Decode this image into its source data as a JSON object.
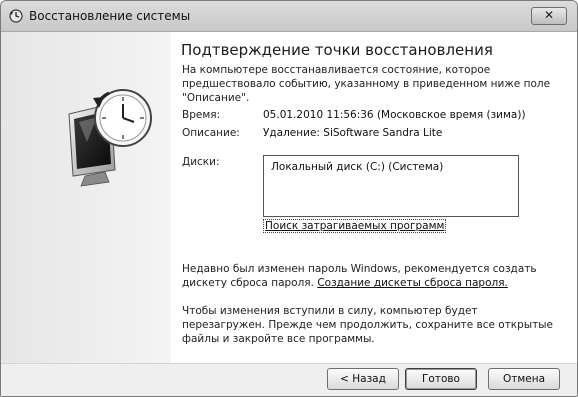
{
  "window": {
    "title": "Восстановление системы",
    "close_label": "✕"
  },
  "main": {
    "heading": "Подтверждение точки восстановления",
    "description": "На компьютере восстанавливается состояние, которое предшествовало событию, указанному в приведенном ниже поле \"Описание\".",
    "time_label": "Время:",
    "time_value": "05.01.2010 11:56:36 (Московское время (зима))",
    "description_label": "Описание:",
    "description_value": "Удаление: SiSoftware Sandra Lite",
    "disks_label": "Диски:",
    "disks": [
      "Локальный диск (C:) (Система)"
    ],
    "scan_link": "Поиск затрагиваемых программ",
    "password_notice": "Недавно был изменен пароль Windows, рекомендуется создать дискету сброса пароля.",
    "password_link": "Создание дискеты сброса пароля.",
    "restart_warning": "Чтобы изменения вступили в силу, компьютер будет перезагружен. Прежде чем продолжить, сохраните все открытые файлы и закройте все программы."
  },
  "buttons": {
    "back": "< Назад",
    "finish": "Готово",
    "cancel": "Отмена"
  },
  "icons": {
    "title": "system-restore-icon",
    "illustration": "monitor-clock-illustration"
  }
}
